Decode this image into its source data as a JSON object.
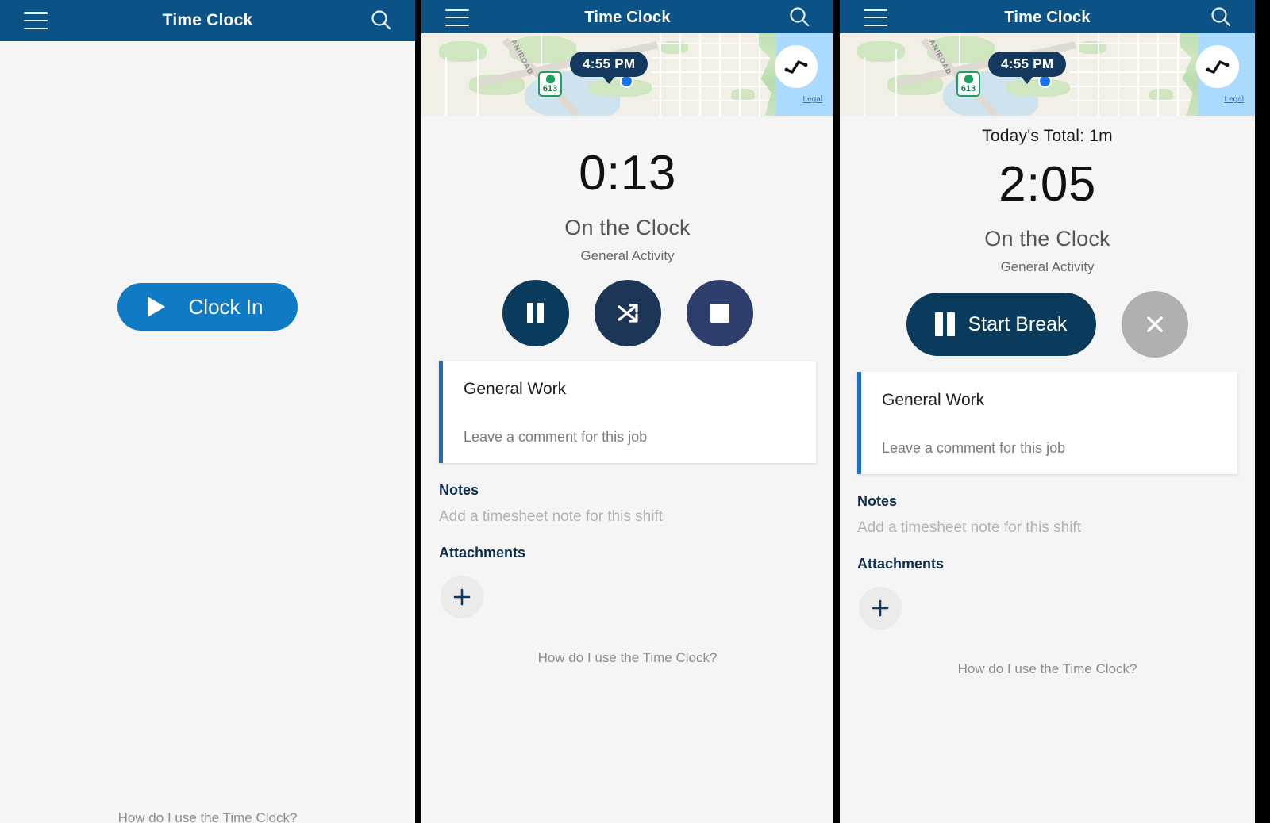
{
  "appbar": {
    "title": "Time Clock",
    "menu_icon": "hamburger-menu-icon",
    "search_icon": "search-icon"
  },
  "map": {
    "time_badge": "4:55 PM",
    "highway_shield": "613",
    "road_label": "ANIROAD",
    "legal_link": "Legal",
    "trend_icon": "activity-trend-icon",
    "location_marker": "current-location-dot"
  },
  "panel1": {
    "clock_in_label": "Clock In",
    "play_icon": "play-icon",
    "help_link": "How do I use the Time Clock?"
  },
  "panel2": {
    "timer": "0:13",
    "status": "On the Clock",
    "activity": "General Activity",
    "actions": [
      {
        "name": "pause",
        "icon": "pause-icon"
      },
      {
        "name": "switch",
        "icon": "shuffle-switch-icon"
      },
      {
        "name": "stop",
        "icon": "stop-square-icon"
      }
    ],
    "job": {
      "title": "General Work",
      "comment_placeholder": "Leave a comment for this job"
    },
    "notes_heading": "Notes",
    "notes_placeholder": "Add a timesheet note for this shift",
    "attachments_heading": "Attachments",
    "add_attachment_icon": "plus-icon",
    "help_link": "How do I use the Time Clock?"
  },
  "panel3": {
    "todays_total": "Today's Total: 1m",
    "timer": "2:05",
    "status": "On the Clock",
    "activity": "General Activity",
    "start_break_label": "Start Break",
    "pause_icon": "pause-icon",
    "cancel_icon": "close-x-icon",
    "job": {
      "title": "General Work",
      "comment_placeholder": "Leave a comment for this job"
    },
    "notes_heading": "Notes",
    "notes_placeholder": "Add a timesheet note for this shift",
    "attachments_heading": "Attachments",
    "add_attachment_icon": "plus-icon",
    "help_link": "How do I use the Time Clock?"
  },
  "colors": {
    "appbar_blue": "#0b5287",
    "clock_in_blue": "#0f7bc4",
    "pause_navy": "#0a3a5c",
    "switch_navy": "#1d3557",
    "stop_navy": "#2e3f6e",
    "cancel_gray": "#b0b0b0",
    "card_accent": "#1f6fc0",
    "heading_navy": "#0d2d4e"
  }
}
